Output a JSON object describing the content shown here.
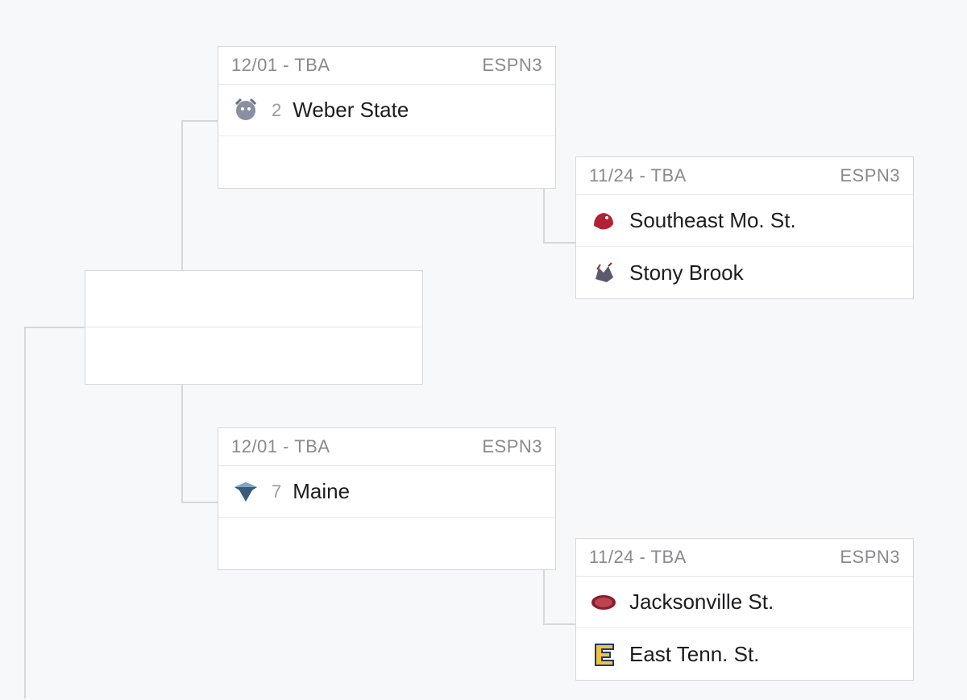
{
  "matchups": {
    "semi_top": {
      "date_time": "12/01 - TBA",
      "network": "ESPN3",
      "teams": [
        {
          "seed": "2",
          "name": "Weber State",
          "logo": "weber"
        },
        {
          "seed": "",
          "name": "",
          "logo": ""
        }
      ]
    },
    "semi_bottom": {
      "date_time": "12/01 - TBA",
      "network": "ESPN3",
      "teams": [
        {
          "seed": "7",
          "name": "Maine",
          "logo": "maine"
        },
        {
          "seed": "",
          "name": "",
          "logo": ""
        }
      ]
    },
    "first_top": {
      "date_time": "11/24 - TBA",
      "network": "ESPN3",
      "teams": [
        {
          "seed": "",
          "name": "Southeast Mo. St.",
          "logo": "semo"
        },
        {
          "seed": "",
          "name": "Stony Brook",
          "logo": "stony"
        }
      ]
    },
    "first_bottom": {
      "date_time": "11/24 - TBA",
      "network": "ESPN3",
      "teams": [
        {
          "seed": "",
          "name": "Jacksonville St.",
          "logo": "jax"
        },
        {
          "seed": "",
          "name": "East Tenn. St.",
          "logo": "etsu"
        }
      ]
    }
  }
}
